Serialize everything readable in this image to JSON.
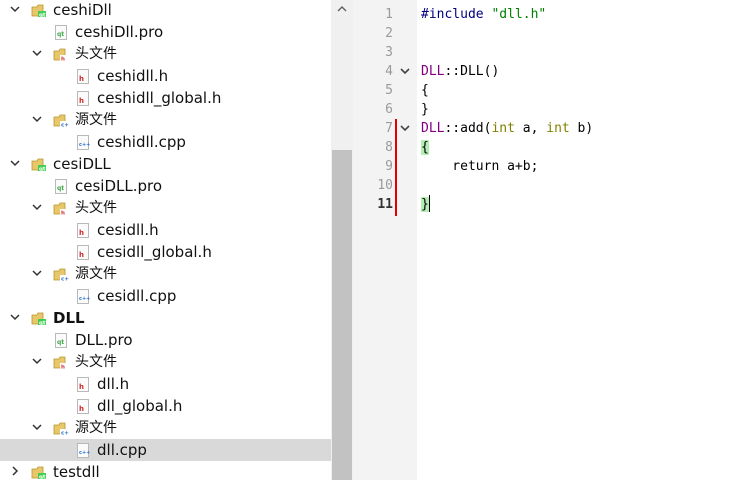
{
  "tree": {
    "items": [
      {
        "label": "ceshiDll",
        "kind": "project",
        "expanded": true
      },
      {
        "label": "ceshiDll.pro",
        "kind": "pro"
      },
      {
        "label": "头文件",
        "kind": "folder-h",
        "expanded": true
      },
      {
        "label": "ceshidll.h",
        "kind": "h"
      },
      {
        "label": "ceshidll_global.h",
        "kind": "h"
      },
      {
        "label": "源文件",
        "kind": "folder-cpp",
        "expanded": true
      },
      {
        "label": "ceshidll.cpp",
        "kind": "cpp"
      },
      {
        "label": "cesiDLL",
        "kind": "project",
        "expanded": true
      },
      {
        "label": "cesiDLL.pro",
        "kind": "pro"
      },
      {
        "label": "头文件",
        "kind": "folder-h",
        "expanded": true
      },
      {
        "label": "cesidll.h",
        "kind": "h"
      },
      {
        "label": "cesidll_global.h",
        "kind": "h"
      },
      {
        "label": "源文件",
        "kind": "folder-cpp",
        "expanded": true
      },
      {
        "label": "cesidll.cpp",
        "kind": "cpp"
      },
      {
        "label": "DLL",
        "kind": "project",
        "expanded": true,
        "active": true
      },
      {
        "label": "DLL.pro",
        "kind": "pro"
      },
      {
        "label": "头文件",
        "kind": "folder-h",
        "expanded": true
      },
      {
        "label": "dll.h",
        "kind": "h"
      },
      {
        "label": "dll_global.h",
        "kind": "h"
      },
      {
        "label": "源文件",
        "kind": "folder-cpp",
        "expanded": true
      },
      {
        "label": "dll.cpp",
        "kind": "cpp",
        "selected": true
      },
      {
        "label": "testdll",
        "kind": "project",
        "expanded": false
      }
    ]
  },
  "editor": {
    "line_numbers": [
      "1",
      "2",
      "3",
      "4",
      "5",
      "6",
      "7",
      "8",
      "9",
      "10",
      "11"
    ],
    "current_line": "11",
    "lines": {
      "l1_directive": "#include",
      "l1_header": "\"dll.h\"",
      "l4_class": "DLL",
      "l4_rest": "::DLL()",
      "l5": "{",
      "l6": "}",
      "l7_class": "DLL",
      "l7_mid": "::add(",
      "l7_type1": "int",
      "l7_arg1": " a, ",
      "l7_type2": "int",
      "l7_arg2": " b)",
      "l8": "{",
      "l9": "    return a+b;",
      "l11": "}"
    }
  },
  "colors": {
    "selection": "#d9d9d9",
    "change_marker": "#e00000",
    "brace_match": "#b4eeb4"
  }
}
